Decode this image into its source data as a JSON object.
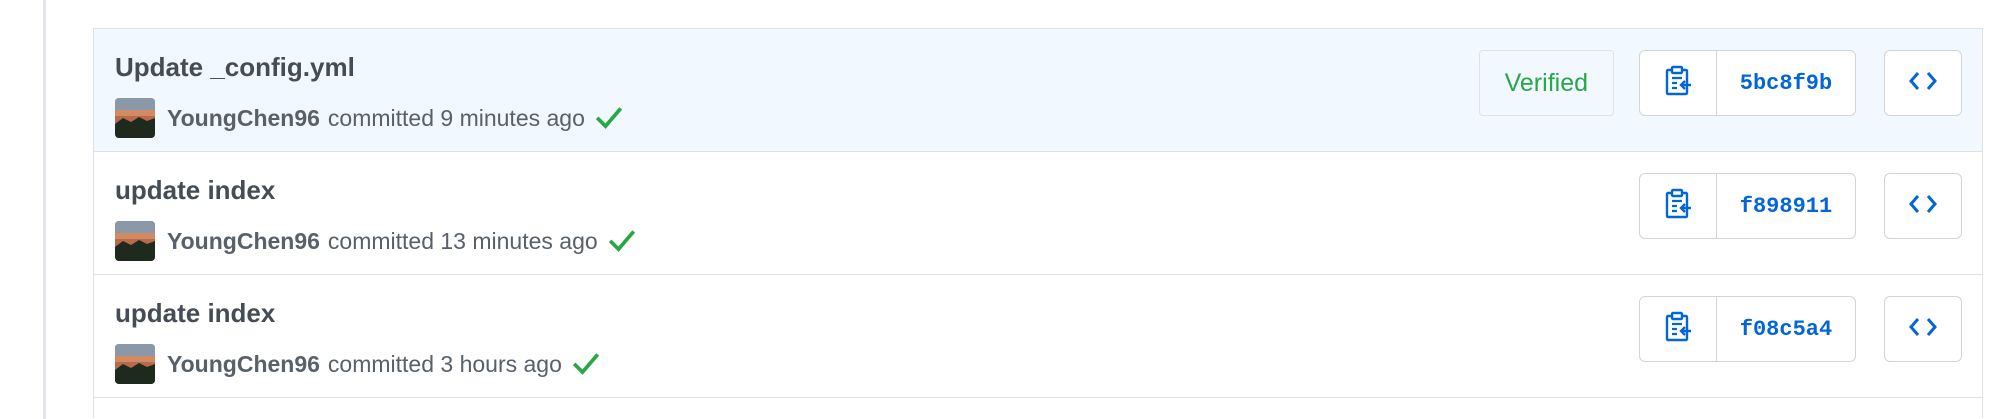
{
  "commits": [
    {
      "title": "Update _config.yml",
      "author": "YoungChen96",
      "committed_text": "committed 9 minutes ago",
      "verified_label": "Verified",
      "sha": "5bc8f9b",
      "status": "success",
      "highlighted": true
    },
    {
      "title": "update index",
      "author": "YoungChen96",
      "committed_text": "committed 13 minutes ago",
      "sha": "f898911",
      "status": "success",
      "highlighted": false
    },
    {
      "title": "update index",
      "author": "YoungChen96",
      "committed_text": "committed 3 hours ago",
      "sha": "f08c5a4",
      "status": "success",
      "highlighted": false
    }
  ],
  "icons": {
    "copy": "clipboard-copy-icon",
    "browse": "code-brackets-icon",
    "status": "check-icon"
  },
  "colors": {
    "highlight_bg": "#f1f8ff",
    "sha_blue": "#0366d6",
    "verified_green": "#28a745",
    "check_green": "#28a745"
  }
}
